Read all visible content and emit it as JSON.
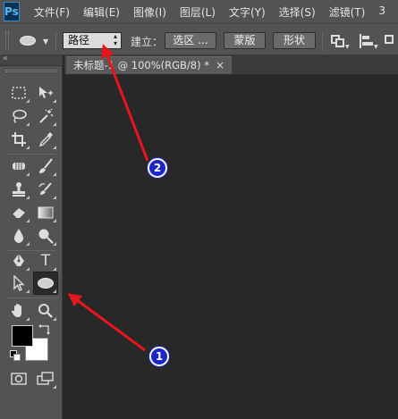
{
  "app": {
    "logo": "Ps"
  },
  "menu": [
    "文件(F)",
    "编辑(E)",
    "图像(I)",
    "图层(L)",
    "文字(Y)",
    "选择(S)",
    "滤镜(T)",
    "3"
  ],
  "options": {
    "tool_preset_icon": "ellipse-icon",
    "mode_select": "路径",
    "make_label": "建立：",
    "selection_button": "选区 ...",
    "mask_button": "蒙版",
    "shape_button": "形状"
  },
  "toolbar": {
    "collapse": "‹‹",
    "tools": [
      {
        "icon": "rectangular-marquee-icon"
      },
      {
        "icon": "move-icon"
      },
      {
        "icon": "lasso-icon"
      },
      {
        "icon": "magic-wand-icon"
      },
      {
        "icon": "crop-icon"
      },
      {
        "icon": "eyedropper-icon"
      },
      {
        "icon": "healing-brush-icon"
      },
      {
        "icon": "brush-icon"
      },
      {
        "icon": "clone-stamp-icon"
      },
      {
        "icon": "history-brush-icon"
      },
      {
        "icon": "eraser-icon"
      },
      {
        "icon": "gradient-icon"
      },
      {
        "icon": "blur-icon"
      },
      {
        "icon": "dodge-icon"
      },
      {
        "icon": "pen-icon"
      },
      {
        "icon": "type-icon",
        "glyph": "T"
      },
      {
        "icon": "path-selection-icon"
      },
      {
        "icon": "ellipse-tool-icon"
      },
      {
        "icon": "hand-icon"
      },
      {
        "icon": "zoom-icon"
      }
    ],
    "foreground_color": "#000000",
    "background_color": "#ffffff"
  },
  "document": {
    "tab_title": "未标题-1 @ 100%(RGB/8) *",
    "close": "×"
  },
  "annotations": [
    {
      "number": "1",
      "points_to": "ellipse-tool"
    },
    {
      "number": "2",
      "points_to": "mode-select"
    }
  ],
  "colors": {
    "annotation_arrow": "#e8161c",
    "badge": "#1a26c9"
  }
}
